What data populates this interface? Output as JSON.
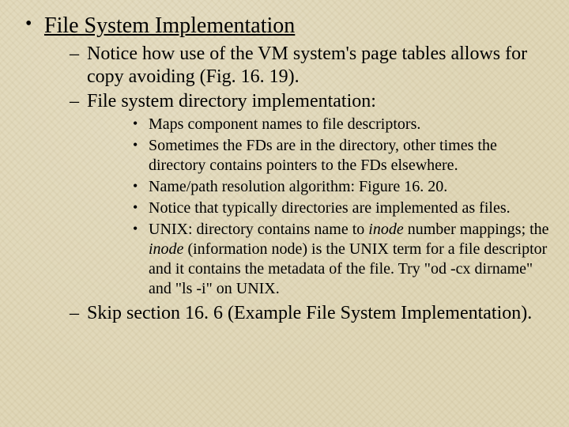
{
  "slide": {
    "title": "File System Implementation",
    "sub": [
      "Notice how use of the VM system's page tables allows for copy avoiding (Fig. 16. 19).",
      "File system directory implementation:",
      "Skip section 16. 6 (Example File System Implementation)."
    ],
    "detail": {
      "d0": "Maps component names to file descriptors.",
      "d1": "Sometimes the FDs are in the directory, other times the directory contains pointers to the FDs elsewhere.",
      "d2": "Name/path resolution algorithm: Figure 16. 20.",
      "d3": "Notice that typically directories are implemented as files.",
      "d4_a": "UNIX: directory contains name to ",
      "d4_b": " number mappings; the ",
      "d4_c": " (information node) is the UNIX term for a file descriptor and it contains the metadata of the file.  Try \"od -cx dirname\" and \"ls -i\" on UNIX.",
      "inode": "inode"
    }
  }
}
